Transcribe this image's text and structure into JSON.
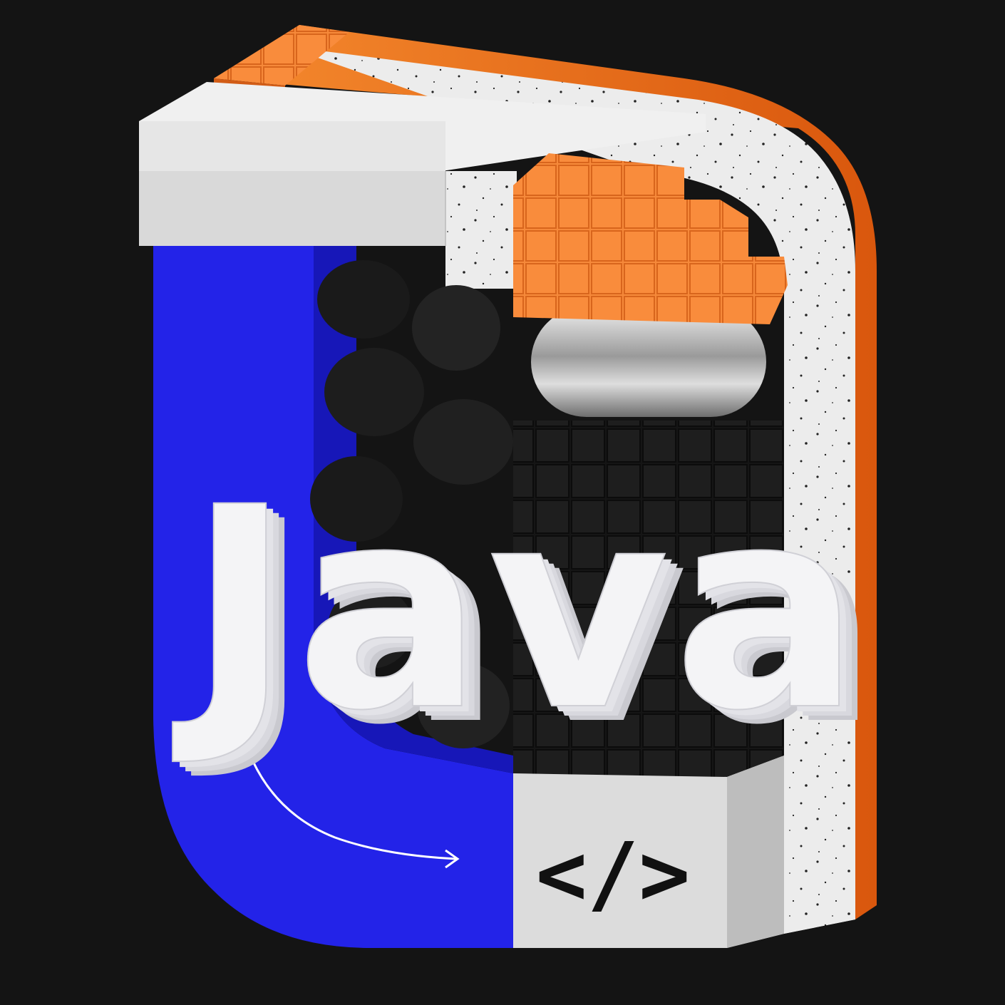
{
  "artwork": {
    "title_text": "Java",
    "code_symbol": "</>",
    "icons": [
      "code-brackets-icon",
      "curved-arrow-icon"
    ],
    "colors": {
      "background": "#141414",
      "blue": "#2424e6",
      "orange": "#f47a22",
      "light_gray": "#dcdcdc",
      "speckled_white": "#ededed",
      "black": "#1c1c1c",
      "chrome": "#b8b8b8",
      "letter_white": "#f4f4f6"
    }
  }
}
